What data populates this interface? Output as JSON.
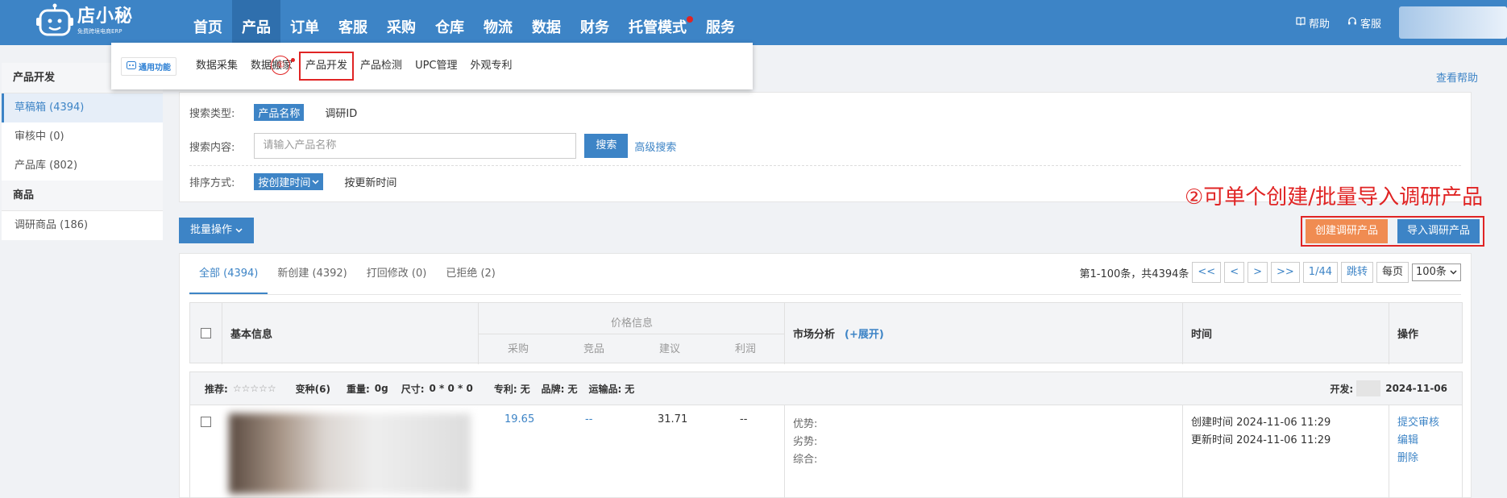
{
  "app": {
    "brand": "店小秘",
    "brand_sub": "免费跨境电商ERP",
    "accent": "#3d84c6",
    "annotation_color": "#e02424"
  },
  "nav": {
    "items": [
      "首页",
      "产品",
      "订单",
      "客服",
      "采购",
      "仓库",
      "物流",
      "数据",
      "财务",
      "托管模式",
      "服务"
    ],
    "active": "产品"
  },
  "top_right": {
    "help": "帮助",
    "service": "客服"
  },
  "dropdown": {
    "tag": "通用功能",
    "links": [
      "数据采集",
      "数据搬家",
      "产品开发",
      "产品检测",
      "UPC管理",
      "外观专利"
    ],
    "highlighted": "产品开发",
    "step_marker": "①"
  },
  "sidebar": {
    "section1": "产品开发",
    "items1": [
      "草稿箱 (4394)",
      "审核中 (0)",
      "产品库 (802)"
    ],
    "section2": "商品",
    "items2": [
      "调研商品 (186)"
    ]
  },
  "help_link": "查看帮助",
  "search": {
    "type_label": "搜索类型:",
    "type_active": "产品名称",
    "type_other": "调研ID",
    "content_label": "搜索内容:",
    "placeholder": "请输入产品名称",
    "search_btn": "搜索",
    "advanced": "高级搜索",
    "sort_label": "排序方式:",
    "sort_active": "按创建时间",
    "sort_other": "按更新时间"
  },
  "toolbar": {
    "bulk": "批量操作",
    "annotation": "②可单个创建/批量导入调研产品",
    "create_btn": "创建调研产品",
    "import_btn": "导入调研产品"
  },
  "tabs": [
    "全部 (4394)",
    "新创建 (4392)",
    "打回修改 (0)",
    "已拒绝 (2)"
  ],
  "pager": {
    "summary": "第1-100条，共4394条",
    "first": "<<",
    "prev": "<",
    "next": ">",
    "last": ">>",
    "page": "1/44",
    "jump": "跳转",
    "per_page_label": "每页",
    "per_page": "100条"
  },
  "table": {
    "basic_info": "基本信息",
    "price_info": "价格信息",
    "price_cols": [
      "采购",
      "竞品",
      "建议",
      "利润"
    ],
    "market": "市场分析",
    "expand": "(+展开)",
    "time": "时间",
    "ops": "操作"
  },
  "product": {
    "recommend_label": "推荐:",
    "stars": "☆☆☆☆☆",
    "variants": "变种(6)",
    "weight_label": "重量:",
    "weight": "0g",
    "size_label": "尺寸:",
    "size": "0 * 0 * 0",
    "patent_label": "专利:",
    "patent": "无",
    "brand_label": "品牌:",
    "brand": "无",
    "shipping_label": "运输品:",
    "shipping": "无",
    "dev_label": "开发:",
    "dev_date": "2024-11-06",
    "purchase": "19.65",
    "competitor": "--",
    "suggested": "31.71",
    "profit": "--",
    "market_lines": [
      "优势:",
      "劣势:",
      "综合:"
    ],
    "created": "创建时间 2024-11-06 11:29",
    "updated": "更新时间 2024-11-06 11:29",
    "actions": [
      "提交审核",
      "编辑",
      "删除"
    ]
  }
}
